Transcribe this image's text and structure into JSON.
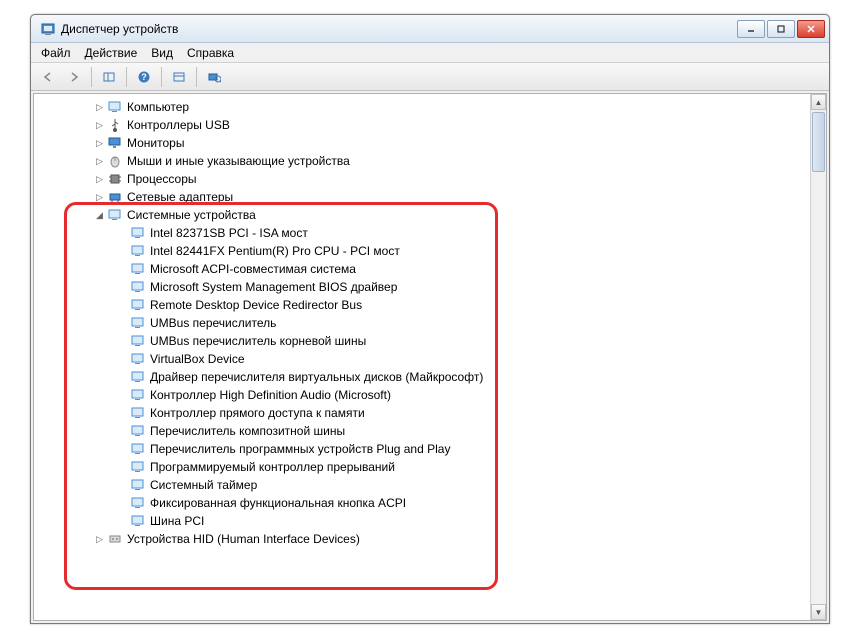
{
  "window": {
    "title": "Диспетчер устройств"
  },
  "menu": {
    "file": "Файл",
    "action": "Действие",
    "view": "Вид",
    "help": "Справка"
  },
  "tree": {
    "top_categories": [
      "Компьютер",
      "Контроллеры USB",
      "Мониторы",
      "Мыши и иные указывающие устройства",
      "Процессоры",
      "Сетевые адаптеры"
    ],
    "system_devices_label": "Системные устройства",
    "system_devices": [
      "Intel 82371SB PCI - ISA мост",
      "Intel 82441FX Pentium(R) Pro CPU - PCI мост",
      "Microsoft ACPI-совместимая система",
      "Microsoft System Management BIOS драйвер",
      "Remote Desktop Device Redirector Bus",
      "UMBus перечислитель",
      "UMBus перечислитель корневой шины",
      "VirtualBox Device",
      "Драйвер перечислителя виртуальных дисков (Майкрософт)",
      "Контроллер High Definition Audio (Microsoft)",
      "Контроллер прямого доступа к памяти",
      "Перечислитель композитной шины",
      "Перечислитель программных устройств Plug and Play",
      "Программируемый контроллер прерываний",
      "Системный таймер",
      "Фиксированная функциональная кнопка ACPI",
      "Шина PCI"
    ],
    "hid_label": "Устройства HID (Human Interface Devices)"
  }
}
